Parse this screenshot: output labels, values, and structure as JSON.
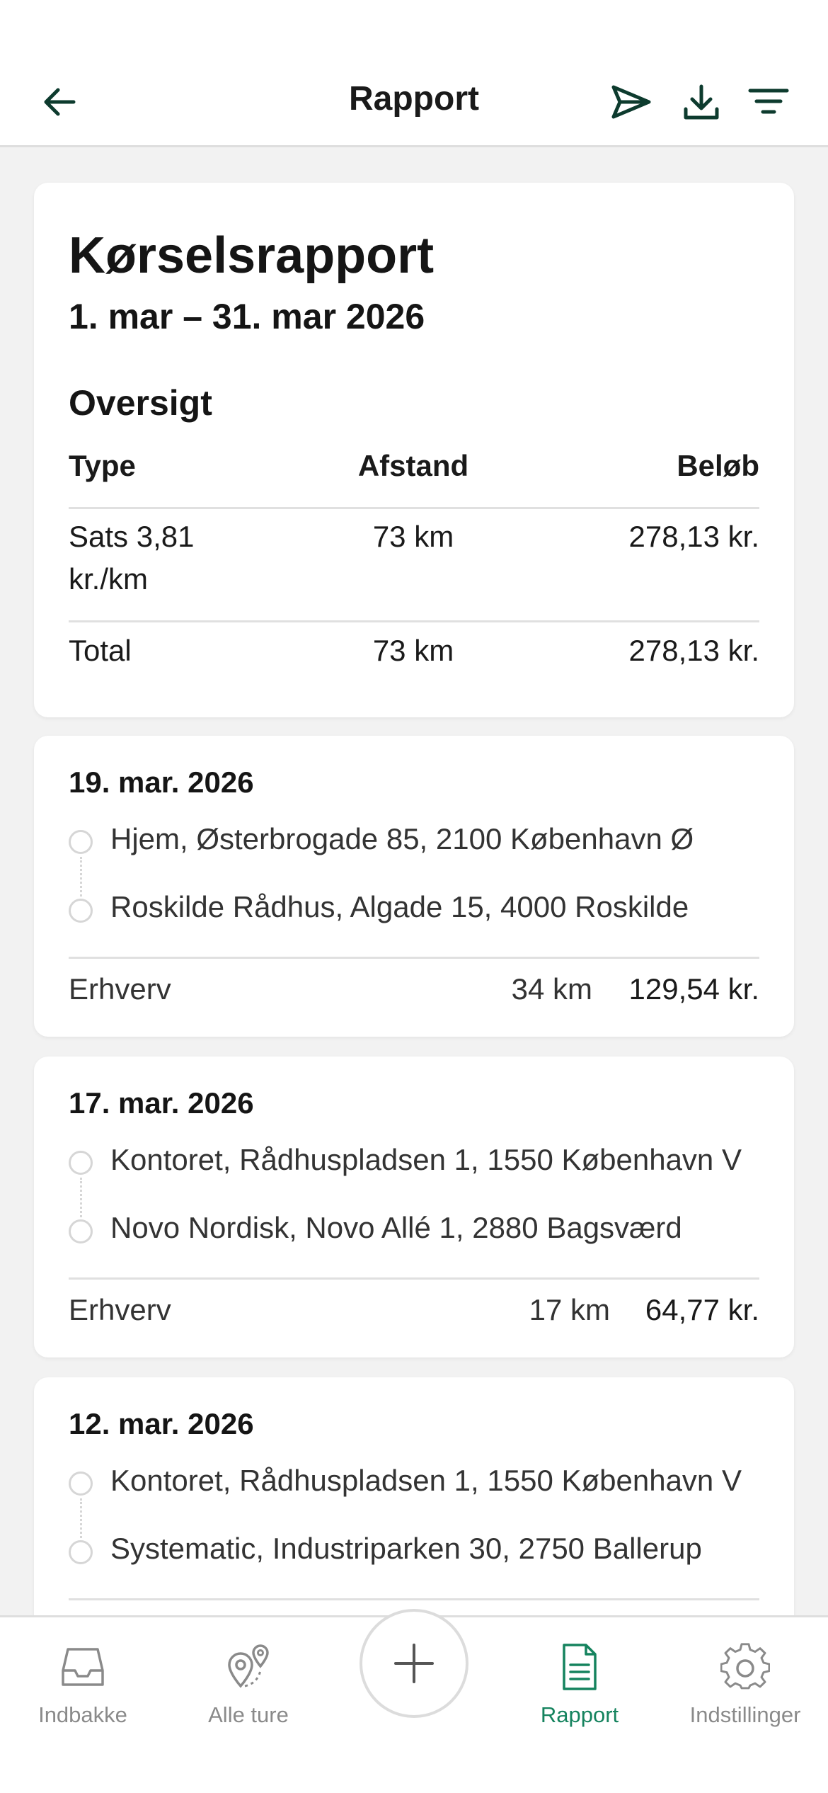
{
  "header": {
    "title": "Rapport",
    "back_icon": "arrow-left-icon",
    "send_icon": "send-icon",
    "download_icon": "download-icon",
    "filter_icon": "filter-icon"
  },
  "colors": {
    "accent": "#15835e",
    "icon_dark": "#0d3b2e",
    "muted": "#8a8a8a"
  },
  "report": {
    "title": "Kørselsrapport",
    "period": "1. mar – 31. mar 2026",
    "overview_title": "Oversigt",
    "columns": {
      "type": "Type",
      "distance": "Afstand",
      "amount": "Beløb"
    },
    "rows": [
      {
        "type_line1": "Sats 3,81",
        "type_line2": "kr./km",
        "distance": "73 km",
        "amount": "278,13 kr."
      }
    ],
    "total": {
      "label": "Total",
      "distance": "73 km",
      "amount": "278,13 kr."
    }
  },
  "trips": [
    {
      "date": "19. mar. 2026",
      "from": "Hjem, Østerbrogade 85, 2100 København Ø",
      "to": "Roskilde Rådhus, Algade 15, 4000 Roskilde",
      "category": "Erhverv",
      "distance": "34 km",
      "amount": "129,54 kr."
    },
    {
      "date": "17. mar. 2026",
      "from": "Kontoret, Rådhuspladsen 1, 1550 København V",
      "to": "Novo Nordisk, Novo Allé 1, 2880 Bagsværd",
      "category": "Erhverv",
      "distance": "17 km",
      "amount": "64,77 kr."
    },
    {
      "date": "12. mar. 2026",
      "from": "Kontoret, Rådhuspladsen 1, 1550 København V",
      "to": "Systematic, Industriparken 30, 2750 Ballerup",
      "category": "",
      "distance": "",
      "amount": ""
    }
  ],
  "nav": {
    "items": [
      {
        "label": "Indbakke",
        "icon": "inbox-icon"
      },
      {
        "label": "Alle ture",
        "icon": "map-pins-icon"
      },
      {
        "label": "",
        "icon": "plus-icon"
      },
      {
        "label": "Rapport",
        "icon": "document-icon"
      },
      {
        "label": "Indstillinger",
        "icon": "gear-icon"
      }
    ],
    "active": "Rapport"
  }
}
